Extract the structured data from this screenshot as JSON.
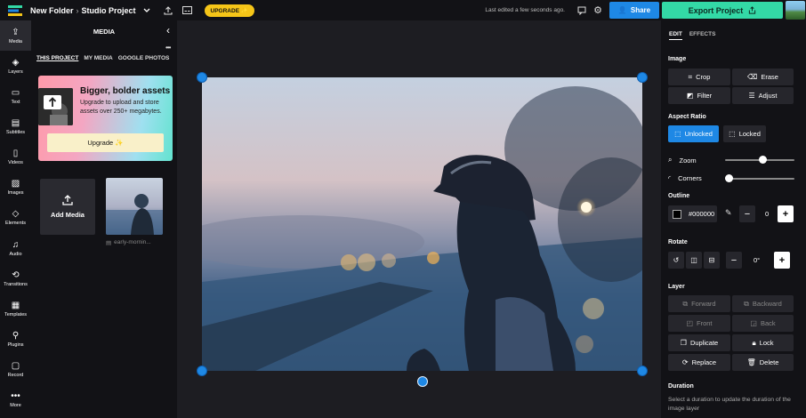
{
  "topbar": {
    "folder": "New Folder",
    "separator": "›",
    "project": "Studio Project",
    "upgrade_label": "UPGRADE ✨",
    "last_edited": "Last edited a few seconds ago.",
    "share_label": "Share",
    "export_label": "Export Project"
  },
  "rail": [
    {
      "label": "Media",
      "icon": "media-icon"
    },
    {
      "label": "Layers",
      "icon": "layers-icon"
    },
    {
      "label": "Text",
      "icon": "text-icon"
    },
    {
      "label": "Subtitles",
      "icon": "subtitles-icon"
    },
    {
      "label": "Videos",
      "icon": "videos-icon"
    },
    {
      "label": "Images",
      "icon": "images-icon"
    },
    {
      "label": "Elements",
      "icon": "elements-icon"
    },
    {
      "label": "Audio",
      "icon": "audio-icon"
    },
    {
      "label": "Transitions",
      "icon": "transitions-icon"
    },
    {
      "label": "Templates",
      "icon": "templates-icon"
    },
    {
      "label": "Plugins",
      "icon": "plugins-icon"
    },
    {
      "label": "Record",
      "icon": "record-icon"
    },
    {
      "label": "More",
      "icon": "more-icon"
    }
  ],
  "media_panel": {
    "title": "MEDIA",
    "tabs": [
      "THIS PROJECT",
      "MY MEDIA",
      "GOOGLE PHOTOS"
    ],
    "promo_title": "Bigger, bolder assets",
    "promo_text": "Upgrade to upload and store assets over 250+ megabytes.",
    "promo_button": "Upgrade ✨",
    "add_media": "Add Media",
    "file_name": "early-mornin..."
  },
  "right_panel": {
    "tabs": [
      "EDIT",
      "EFFECTS"
    ],
    "image_section": "Image",
    "crop": "Crop",
    "erase": "Erase",
    "filter": "Filter",
    "adjust": "Adjust",
    "aspect_section": "Aspect Ratio",
    "unlocked": "Unlocked",
    "locked": "Locked",
    "zoom_label": "Zoom",
    "zoom_level": 0.55,
    "corners_label": "Corners",
    "corners_level": 0.0,
    "outline_section": "Outline",
    "outline_color": "#000000",
    "outline_width": "0",
    "rotate_section": "Rotate",
    "rotate_value": "0°",
    "layer_section": "Layer",
    "forward": "Forward",
    "backward": "Backward",
    "front": "Front",
    "back": "Back",
    "duplicate": "Duplicate",
    "lock": "Lock",
    "replace": "Replace",
    "delete": "Delete",
    "duration_section": "Duration",
    "duration_desc": "Select a duration to update the duration of the image layer"
  },
  "colors": {
    "accent": "#1e88e5",
    "export": "#33d9a6",
    "upgrade": "#f5c518"
  }
}
